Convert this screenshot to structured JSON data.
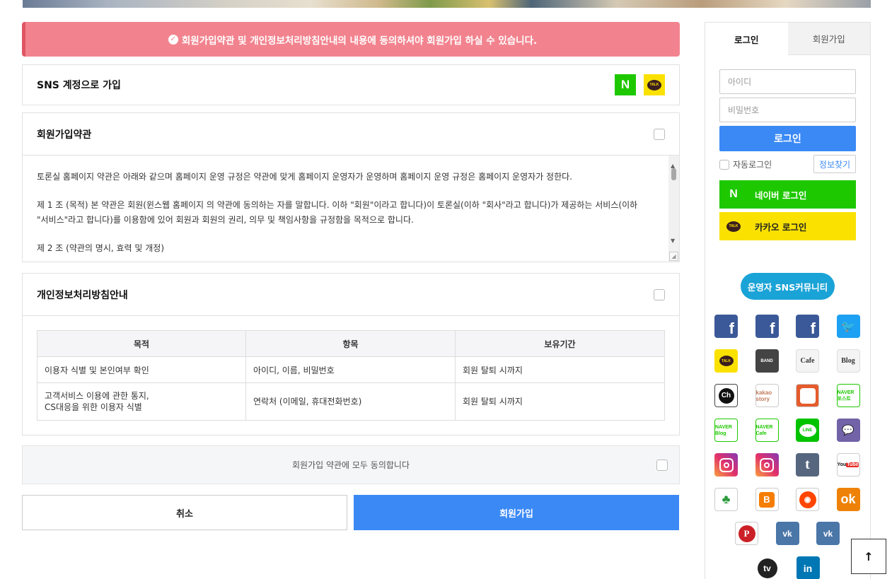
{
  "alert": {
    "text": "회원가입약관 및 개인정보처리방침안내의 내용에 동의하셔야 회원가입 하실 수 있습니다."
  },
  "sns_signup": {
    "title": "SNS 계정으로 가입",
    "naver_glyph": "N",
    "kakao_glyph": "TALK"
  },
  "terms": {
    "title": "회원가입약관",
    "paragraphs": [
      "토론실 홈페이지  약관은 아래와 같으며 홈페이지  운영 규정은 약관에 맞게 홈페이지 운영자가 운영하며 홈페이지  운영 규정은 홈페이지 운영자가 정한다.",
      "제 1 조 (목적) 본 약관은 회원(윈스웹 홈페이지 의 약관에 동의하는 자를 말합니다. 이하 \"회원\"이라고 합니다)이 토론실(이하 \"회사\"라고 합니다)가 제공하는 서비스(이하 \"서비스\"라고 합니다)를 이용함에 있어 회원과 회원의 권리, 의무 및 책임사항을 규정함을 목적으로 합니다.",
      "제 2 조 (약관의 명시, 효력 및 개정)"
    ]
  },
  "privacy": {
    "title": "개인정보처리방침안내",
    "headers": [
      "목적",
      "항목",
      "보유기간"
    ],
    "rows": [
      [
        "이용자 식별 및 본인여부 확인",
        "아이디, 이름, 비밀번호",
        "회원 탈퇴 시까지"
      ],
      [
        "고객서비스 이용에 관한 통지,\nCS대응을 위한 이용자 식별",
        "연락처 (이메일, 휴대전화번호)",
        "회원 탈퇴 시까지"
      ]
    ]
  },
  "agree_all": {
    "label": "회원가입 약관에 모두 동의합니다"
  },
  "buttons": {
    "cancel": "취소",
    "join": "회원가입"
  },
  "sidebar": {
    "tabs": [
      "로그인",
      "회원가입"
    ],
    "id_placeholder": "아이디",
    "pw_placeholder": "비밀번호",
    "login_button": "로그인",
    "auto_login": "자동로그인",
    "find_info": "정보찾기",
    "naver_login": "네이버 로그인",
    "kakao_login": "카카오 로그인",
    "sns_community": "운영자 SNS커뮤니티"
  },
  "sns_icons": [
    {
      "name": "facebook-icon",
      "cls": "fb",
      "glyph": "f"
    },
    {
      "name": "facebook-icon",
      "cls": "fb",
      "glyph": "f"
    },
    {
      "name": "facebook-icon",
      "cls": "fb",
      "glyph": "f"
    },
    {
      "name": "twitter-icon",
      "cls": "tw",
      "glyph": "🐦"
    },
    {
      "name": "kakaotalk-icon",
      "cls": "kt",
      "glyph": "TALK"
    },
    {
      "name": "band-icon",
      "cls": "band",
      "glyph": "BAND"
    },
    {
      "name": "daum-cafe-icon",
      "cls": "daum",
      "glyph": "Cafe"
    },
    {
      "name": "daum-blog-icon",
      "cls": "daum",
      "glyph": "Blog"
    },
    {
      "name": "kakao-channel-icon",
      "cls": "ch",
      "glyph": "Ch"
    },
    {
      "name": "kakao-story-icon",
      "cls": "kstory",
      "glyph": "kakao story"
    },
    {
      "name": "dots-icon",
      "cls": "dots",
      "glyph": ""
    },
    {
      "name": "naver-post-icon",
      "cls": "nav-box",
      "glyph": "NAVER 포스트"
    },
    {
      "name": "naver-blog-icon",
      "cls": "nav-box",
      "glyph": "NAVER Blog"
    },
    {
      "name": "naver-cafe-icon",
      "cls": "nav-box",
      "glyph": "NAVER Cafe"
    },
    {
      "name": "line-icon",
      "cls": "line",
      "glyph": "LINE"
    },
    {
      "name": "chat-icon",
      "cls": "chat",
      "glyph": "💬"
    },
    {
      "name": "instagram-icon",
      "cls": "insta",
      "glyph": ""
    },
    {
      "name": "instagram-icon",
      "cls": "insta",
      "glyph": ""
    },
    {
      "name": "tumblr-icon",
      "cls": "tumblr",
      "glyph": "t"
    },
    {
      "name": "youtube-icon",
      "cls": "yt",
      "glyph": "YouTube"
    },
    {
      "name": "mascot-icon",
      "cls": "green-robot",
      "glyph": "♣"
    },
    {
      "name": "blogger-icon",
      "cls": "blogger",
      "glyph": "B"
    },
    {
      "name": "reddit-icon",
      "cls": "reddit",
      "glyph": "◉"
    },
    {
      "name": "odnoklassniki-icon",
      "cls": "ok",
      "glyph": "ok"
    }
  ],
  "sns_row7": [
    {
      "name": "pinterest-icon",
      "cls": "pin",
      "glyph": "P"
    },
    {
      "name": "vk-icon",
      "cls": "vk",
      "glyph": "vk"
    },
    {
      "name": "vk-icon",
      "cls": "vk",
      "glyph": "vk"
    }
  ],
  "sns_row8": [
    {
      "name": "tv-icon",
      "cls": "tv",
      "glyph": "tv"
    },
    {
      "name": "linkedin-icon",
      "cls": "li",
      "glyph": "in"
    }
  ],
  "to_top": {
    "glyph": "↑"
  }
}
